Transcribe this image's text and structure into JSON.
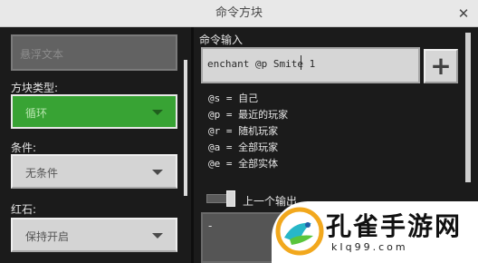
{
  "window": {
    "title": "命令方块",
    "close_glyph": "✕"
  },
  "left_panel": {
    "hover_text_placeholder": "悬浮文本",
    "block_type": {
      "label": "方块类型:",
      "value": "循环",
      "color": "#38a334"
    },
    "condition": {
      "label": "条件:",
      "value": "无条件"
    },
    "redstone": {
      "label": "红石:",
      "value": "保持开启"
    }
  },
  "right_panel": {
    "command_input_label": "命令输入",
    "command_value": "enchant @p Smite 1",
    "add_button_glyph": "+",
    "selectors": [
      {
        "text": "@s = 自己"
      },
      {
        "text": "@p = 最近的玩家"
      },
      {
        "text": "@r = 随机玩家"
      },
      {
        "text": "@a = 全部玩家"
      },
      {
        "text": "@e = 全部实体"
      }
    ],
    "previous_output_label": "上一个输出",
    "previous_output_value": "-"
  },
  "watermark": {
    "title": "孔雀手游网",
    "subtitle": "kIq99.com"
  }
}
